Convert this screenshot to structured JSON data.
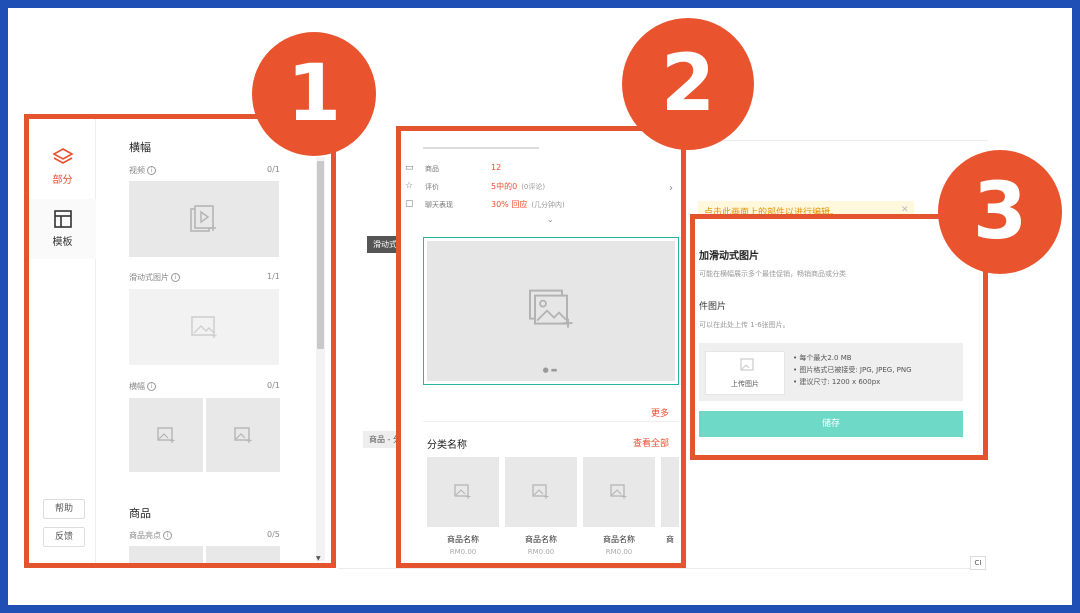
{
  "panel1": {
    "nav": {
      "parts_label": "部分",
      "template_label": "模板"
    },
    "buttons": {
      "help": "帮助",
      "feedback": "反馈"
    },
    "banner_section": {
      "title": "横幅",
      "items": [
        {
          "label": "视频",
          "count": "0/1"
        },
        {
          "label": "滑动式图片",
          "count": "1/1"
        },
        {
          "label": "横幅",
          "count": "0/1"
        }
      ]
    },
    "product_section": {
      "title": "商品",
      "item": {
        "label": "商品亮点",
        "count": "0/5"
      }
    }
  },
  "panel2": {
    "stats": [
      {
        "label": "商品",
        "value": "12",
        "note": ""
      },
      {
        "label": "评价",
        "value": "5中的0",
        "note": "(0评论)"
      },
      {
        "label": "聊天表现",
        "value": "30% 回应",
        "note": "(几分钟内)"
      }
    ],
    "more_link": "更多",
    "category_title": "分类名称",
    "view_all": "查看全部",
    "products": [
      {
        "name": "商品名称",
        "price": "RM0.00"
      },
      {
        "name": "商品名称",
        "price": "RM0.00"
      },
      {
        "name": "商品名称",
        "price": "RM0.00"
      }
    ],
    "partial_product_name": "商"
  },
  "background": {
    "slide_tag": "滑动式图片",
    "product_tag": "商品 - 分类名",
    "notice": "点击此画面上的部件以进行编辑。",
    "ci_label": "CI"
  },
  "panel3": {
    "title": "加滑动式图片",
    "description": "可能在横幅展示多个最佳促销，畅销商品或分类",
    "subtitle": "件图片",
    "hint": "可以在此处上传 1-6张图片。",
    "upload_label": "上传图片",
    "requirements": [
      "• 每个最大2.0 MB",
      "• 图片格式已被接受: JPG, JPEG, PNG",
      "• 建议尺寸: 1200 x 600px"
    ],
    "save_label": "储存"
  },
  "markers": [
    "1",
    "2",
    "3"
  ],
  "colors": {
    "frame": "#e4542f",
    "accent": "#ee4d2d",
    "teal": "#26b5a0",
    "page_border": "#1f4fb5"
  }
}
